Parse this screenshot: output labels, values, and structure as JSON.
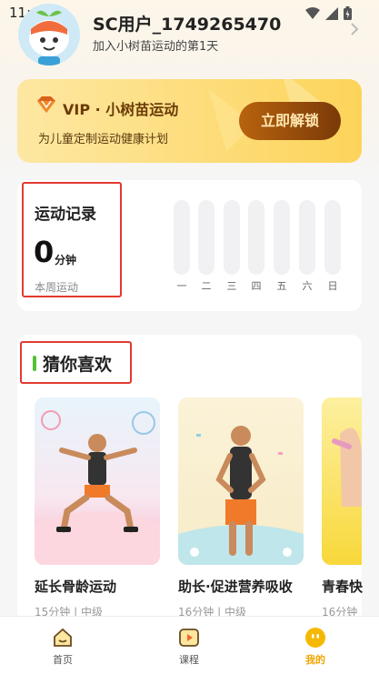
{
  "status": {
    "time": "11:07"
  },
  "user": {
    "name": "SC用户_1749265470",
    "days": "加入小树苗运动的第1天"
  },
  "vip": {
    "title": "VIP · 小树苗运动",
    "subtitle": "为儿童定制运动健康计划",
    "button": "立即解锁"
  },
  "record": {
    "title": "运动记录",
    "minutes": "0",
    "unit": "分钟",
    "period": "本周运动",
    "days": [
      "一",
      "二",
      "三",
      "四",
      "五",
      "六",
      "日"
    ],
    "day_values": [
      0,
      0,
      0,
      0,
      0,
      0,
      0
    ]
  },
  "guess": {
    "title": "猜你喜欢",
    "cards": [
      {
        "title": "延长骨龄运动",
        "meta": "15分钟 | 中级"
      },
      {
        "title": "助长·促进营养吸收",
        "meta": "16分钟 | 中级"
      },
      {
        "title": "青春快",
        "meta": "16分钟"
      }
    ]
  },
  "tabs": [
    {
      "label": "首页",
      "icon": "home-icon",
      "active": false
    },
    {
      "label": "课程",
      "icon": "play-course-icon",
      "active": false
    },
    {
      "label": "我的",
      "icon": "profile-face-icon",
      "active": true
    }
  ],
  "colors": {
    "accent": "#f5b800",
    "highlight_box": "#e23a31",
    "green_mark": "#53c233"
  }
}
